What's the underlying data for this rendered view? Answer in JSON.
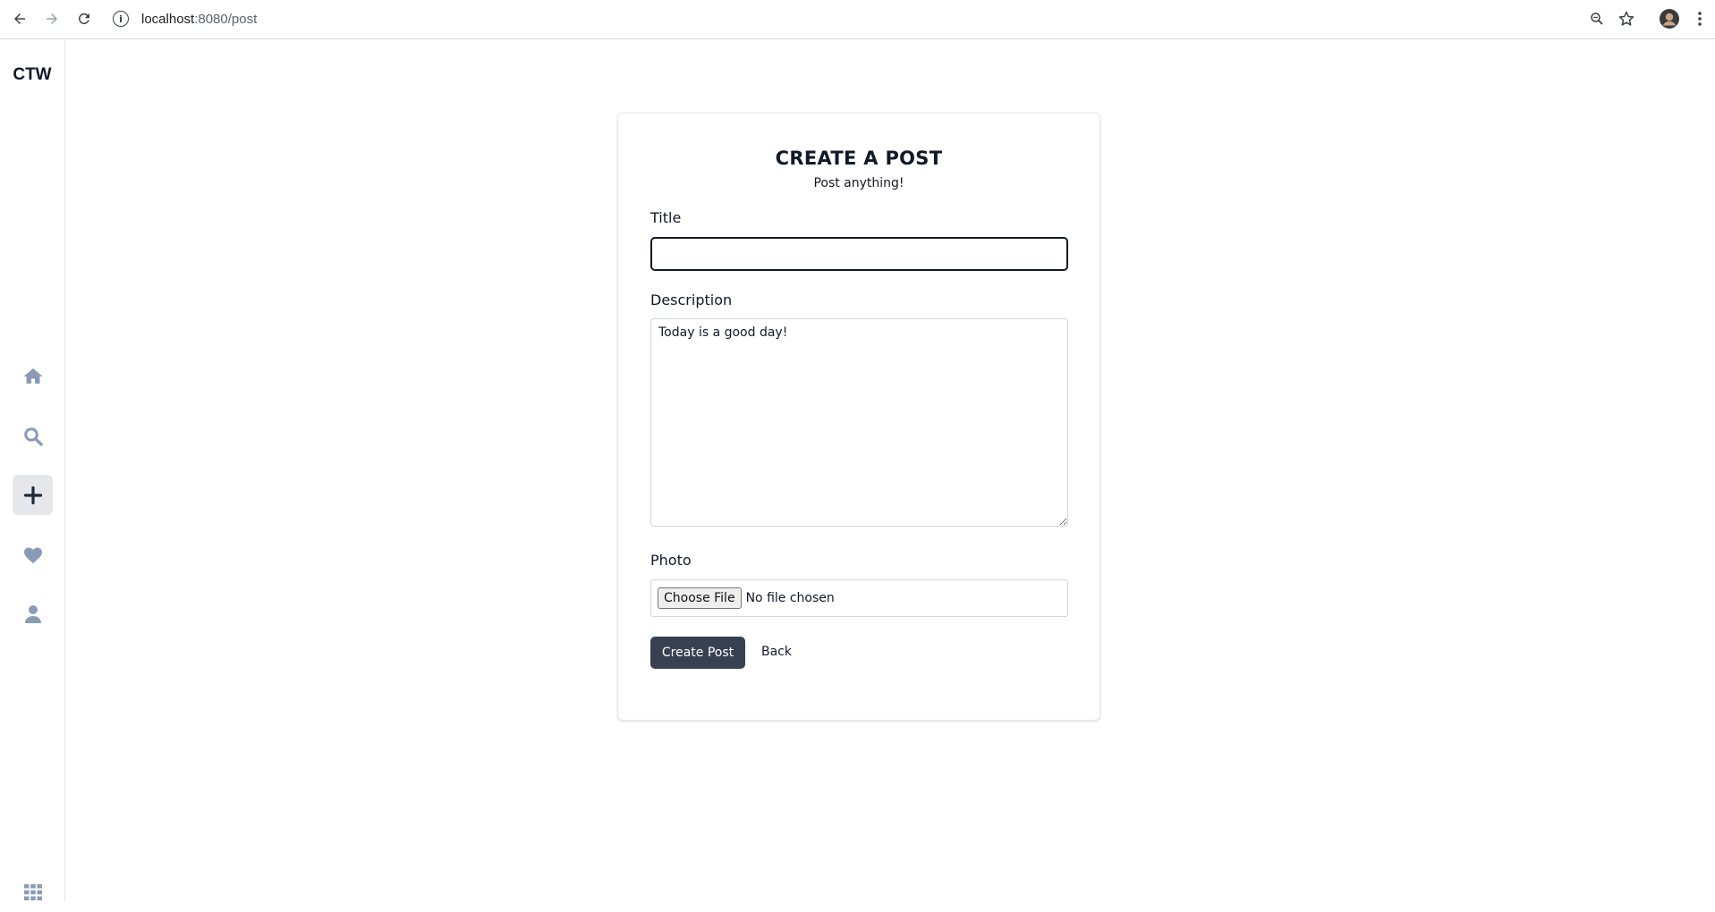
{
  "browser": {
    "url_host": "localhost",
    "url_path": ":8080/post"
  },
  "sidebar": {
    "brand": "CTW",
    "items": [
      {
        "name": "home",
        "active": false
      },
      {
        "name": "search",
        "active": false
      },
      {
        "name": "create",
        "active": true
      },
      {
        "name": "likes",
        "active": false
      },
      {
        "name": "profile",
        "active": false
      },
      {
        "name": "apps",
        "active": false
      }
    ],
    "icon_color": "#8a9bb5"
  },
  "form": {
    "heading": "CREATE A POST",
    "subheading": "Post anything!",
    "title_label": "Title",
    "title_value": "",
    "description_label": "Description",
    "description_value": "Today is a good day!",
    "photo_label": "Photo",
    "file_button_label": "Choose File",
    "file_status": "No file chosen",
    "submit_label": "Create Post",
    "back_label": "Back"
  },
  "colors": {
    "primary_button": "#374151",
    "active_nav_bg": "#e5e7eb"
  }
}
